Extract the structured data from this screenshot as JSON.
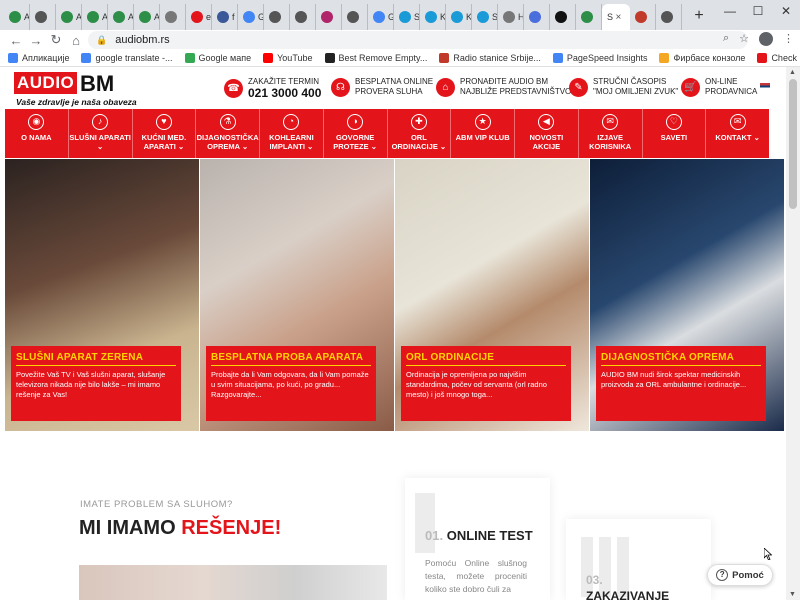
{
  "browser": {
    "tabs": [
      {
        "label": "A",
        "color": "#2d8f47"
      },
      {
        "label": "",
        "color": "#555"
      },
      {
        "label": "A",
        "color": "#2d8f47"
      },
      {
        "label": "A",
        "color": "#2d8f47"
      },
      {
        "label": "A",
        "color": "#2d8f47"
      },
      {
        "label": "A",
        "color": "#2d8f47"
      },
      {
        "label": "",
        "color": "#777"
      },
      {
        "label": "e",
        "color": "#e3151b"
      },
      {
        "label": "f",
        "color": "#3b5998"
      },
      {
        "label": "G",
        "color": "#4285f4"
      },
      {
        "label": "",
        "color": "#555"
      },
      {
        "label": "",
        "color": "#555"
      },
      {
        "label": "",
        "color": "#b0246a"
      },
      {
        "label": "",
        "color": "#555"
      },
      {
        "label": "G",
        "color": "#4285f4"
      },
      {
        "label": "S",
        "color": "#1a9bd7"
      },
      {
        "label": "K",
        "color": "#1a9bd7"
      },
      {
        "label": "K",
        "color": "#1a9bd7"
      },
      {
        "label": "S",
        "color": "#1a9bd7"
      },
      {
        "label": "Нов",
        "color": "#777"
      },
      {
        "label": "",
        "color": "#4a6fdc"
      },
      {
        "label": "",
        "color": "#111"
      },
      {
        "label": "",
        "color": "#2d8f47"
      }
    ],
    "active_tab": {
      "label": "S",
      "close": "×"
    },
    "tabs_after": [
      {
        "label": "",
        "color": "#c0392b"
      },
      {
        "label": "",
        "color": "#555"
      }
    ],
    "new_tab": "+",
    "window": {
      "minimize": "—",
      "maximize": "☐",
      "close": "✕"
    },
    "url": "audiobm.rs",
    "bookmarks": [
      {
        "label": "Апликације",
        "color": "#4285f4"
      },
      {
        "label": "google translate -...",
        "color": "#4285f4"
      },
      {
        "label": "Google мапе",
        "color": "#34a853"
      },
      {
        "label": "YouTube",
        "color": "#ff0000"
      },
      {
        "label": "Best Remove Empty...",
        "color": "#222"
      },
      {
        "label": "Radio stanice Srbije...",
        "color": "#c0392b"
      },
      {
        "label": "PageSpeed Insights",
        "color": "#4285f4"
      },
      {
        "label": "Фирбасе конзоле",
        "color": "#f5a623"
      },
      {
        "label": "Check Page Rank -...",
        "color": "#e3151b"
      }
    ]
  },
  "header": {
    "logo_audio": "AUDIO",
    "logo_bm": "BM",
    "slogan": "Vaše zdravlje je naša obaveza",
    "contacts": [
      {
        "icon": "☎",
        "line1": "ZAKAŽITE TERMIN",
        "line2": "021 3000 400",
        "big": true
      },
      {
        "icon": "☊",
        "line1": "BESPLATNA ONLINE",
        "line2": "PROVERA SLUHA",
        "big": false
      },
      {
        "icon": "⌂",
        "line1": "PRONAĐITE AUDIO BM",
        "line2": "NAJBLIŽE PREDSTAVNIŠTVO",
        "big": false
      },
      {
        "icon": "✎",
        "line1": "STRUČNI ČASOPIS",
        "line2": "\"MOJ OMILJENI ZVUK\"",
        "big": false
      },
      {
        "icon": "🛒",
        "line1": "ON-LINE",
        "line2": "PRODAVNICA",
        "big": false
      }
    ]
  },
  "nav": [
    {
      "label": "O NAMA",
      "icon": "◉"
    },
    {
      "label": "SLUŠNI APARATI ⌄",
      "icon": "♪"
    },
    {
      "label": "KUĆNI MED. APARATI ⌄",
      "icon": "♥"
    },
    {
      "label": "DIJAGNOSTIČKA OPREMA ⌄",
      "icon": "⚗"
    },
    {
      "label": "KOHLEARNI IMPLANTI ⌄",
      "icon": "◔"
    },
    {
      "label": "GOVORNE PROTEZE ⌄",
      "icon": "◑"
    },
    {
      "label": "ORL ORDINACIJE ⌄",
      "icon": "✚"
    },
    {
      "label": "ABM VIP KLUB",
      "icon": "★"
    },
    {
      "label": "NOVOSTI AKCIJE",
      "icon": "◀"
    },
    {
      "label": "IZJAVE KORISNIKA",
      "icon": "✉"
    },
    {
      "label": "SAVETI",
      "icon": "♡"
    },
    {
      "label": "KONTAKT ⌄",
      "icon": "✉"
    }
  ],
  "tiles": [
    {
      "title": "SLUŠNI APARAT ZERENA",
      "text": "Povežite Vaš TV i Vaš slušni aparat, slušanje televizora nikada nije bilo lakše – mi imamo rešenje za Vas!",
      "bg": "linear-gradient(160deg,#2b2220 0%,#6a4a3a 40%,#c9b48f 70%,#d9c8a6 100%)"
    },
    {
      "title": "BESPLATNA PROBA APARATA",
      "text": "Probajte da li Vam odgovara, da li Vam pomaže u svim situacijama, po kući, po gradu... Razgovarajte...",
      "bg": "linear-gradient(150deg,#b9b2ad 0%,#d9cfc7 35%,#c9a089 60%,#8a5c48 100%)"
    },
    {
      "title": "ORL ORDINACIJE",
      "text": "Ordinacija je opremljena po najvišim standardima, počev od servanta (orl radno mesto) i još mnogo toga...",
      "bg": "linear-gradient(150deg,#d8d3c4 0%,#e8e4d8 40%,#b48a6b 60%,#efe7dc 100%)"
    },
    {
      "title": "DIJAGNOSTIČKA OPREMA",
      "text": "AUDIO BM nudi širok spektar medicinskih proizvoda za ORL ambulantne i ordinacije...",
      "bg": "linear-gradient(150deg,#0d1e38 0%,#28476e 40%,#dadde0 60%,#1a2b4a 100%)"
    }
  ],
  "section": {
    "kicker": "IMATE PROBLEM SA SLUHOM?",
    "title_part1": "MI IMAMO ",
    "title_part2": "REŠENJE!",
    "card1_num": "01.",
    "card1_title": "ONLINE TEST",
    "card1_text": "Pomoću Online slušnog testa, možete proceniti koliko ste dobro čuli za",
    "card2_num": "03.",
    "card2_title": "ZAKAZIVANJE",
    "help": "Pomoć"
  }
}
